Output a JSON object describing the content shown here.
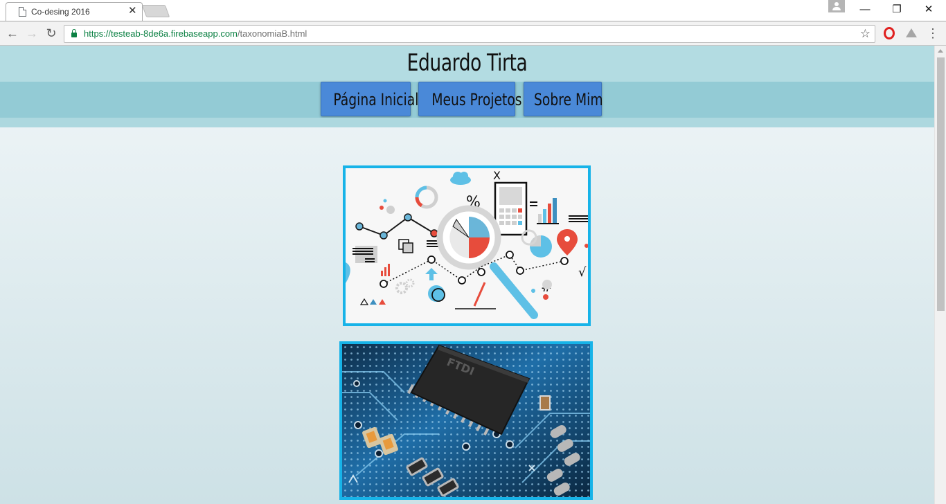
{
  "browser": {
    "tab_title": "Co-desing 2016",
    "url_scheme": "https://",
    "url_host": "testeab-8de6a.firebaseapp.com",
    "url_path": "/taxonomiaB.html",
    "accent_secure": "#0b8043"
  },
  "page": {
    "site_title": "Eduardo Tirta",
    "nav": [
      {
        "label": "Página Inicial"
      },
      {
        "label": "Meus Projetos"
      },
      {
        "label": "Sobre Mim"
      }
    ],
    "colors": {
      "header_bg": "#b3dce2",
      "nav_bg": "#93cbd5",
      "button_bg": "#4a89d8",
      "image_border": "#17b3e8"
    },
    "images": [
      {
        "subject": "data analytics infographic",
        "icons": [
          "cloud-icon",
          "magnifier-icon",
          "calculator-icon",
          "location-pin-icon",
          "bar-chart-icon"
        ],
        "symbols": [
          "%",
          "X",
          "=",
          "#",
          "√"
        ]
      },
      {
        "subject": "circuit board with FTDI chip",
        "chip_text": "FTDI"
      }
    ]
  }
}
